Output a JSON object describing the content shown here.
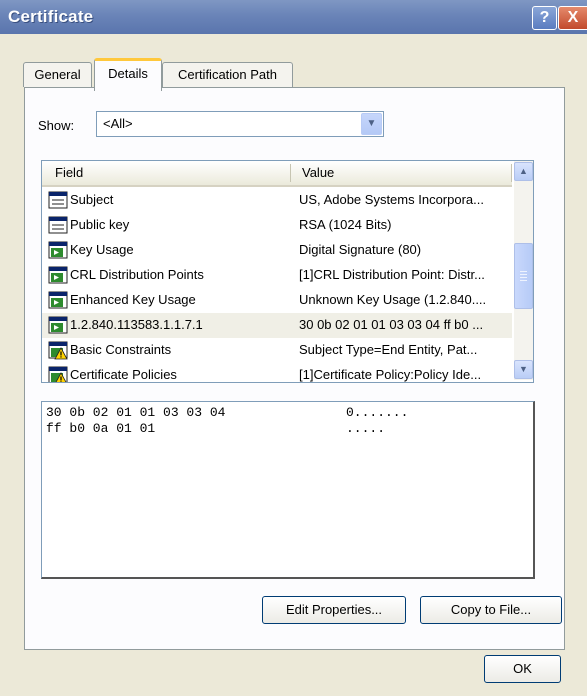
{
  "window": {
    "title": "Certificate",
    "help_label": "?",
    "close_label": "X"
  },
  "tabs": [
    {
      "label": "General"
    },
    {
      "label": "Details"
    },
    {
      "label": "Certification Path"
    }
  ],
  "show": {
    "label": "Show:",
    "value": "<All>"
  },
  "table": {
    "headers": {
      "field": "Field",
      "value": "Value"
    },
    "rows": [
      {
        "field": "Subject",
        "value": "US, Adobe Systems Incorpora...",
        "icon": "field-doc-icon"
      },
      {
        "field": "Public key",
        "value": "RSA (1024 Bits)",
        "icon": "field-doc-icon"
      },
      {
        "field": "Key Usage",
        "value": "Digital Signature (80)",
        "icon": "extension-icon"
      },
      {
        "field": "CRL Distribution Points",
        "value": "[1]CRL Distribution Point: Distr...",
        "icon": "extension-icon"
      },
      {
        "field": "Enhanced Key Usage",
        "value": "Unknown Key Usage (1.2.840....",
        "icon": "extension-icon"
      },
      {
        "field": "1.2.840.113583.1.1.7.1",
        "value": "30 0b 02 01 01 03 03 04 ff b0 ...",
        "icon": "extension-icon",
        "selected": true
      },
      {
        "field": "Basic Constraints",
        "value": "Subject Type=End Entity, Pat...",
        "icon": "critical-extension-icon"
      },
      {
        "field": "Certificate Policies",
        "value": "[1]Certificate Policy:Policy Ide...",
        "icon": "critical-extension-icon"
      }
    ]
  },
  "detail": {
    "lines": [
      {
        "hex": "30 0b 02 01 01 03 03 04",
        "ascii": "0......."
      },
      {
        "hex": "ff b0 0a 01 01",
        "ascii": "....."
      }
    ]
  },
  "buttons": {
    "edit": "Edit Properties...",
    "copy": "Copy to File...",
    "ok": "OK"
  },
  "colors": {
    "titlebar": "#6a84b8",
    "active_tab_accent": "#ffc83c",
    "dialog_bg": "#ece9d8"
  }
}
